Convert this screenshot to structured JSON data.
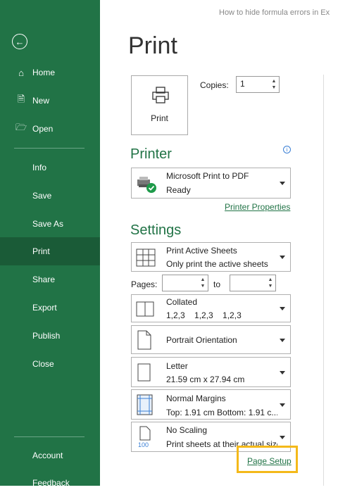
{
  "window": {
    "title": "How to hide formula errors in Ex"
  },
  "sidebar": {
    "items": [
      {
        "label": "Home"
      },
      {
        "label": "New"
      },
      {
        "label": "Open"
      },
      {
        "label": "Info"
      },
      {
        "label": "Save"
      },
      {
        "label": "Save As"
      },
      {
        "label": "Print"
      },
      {
        "label": "Share"
      },
      {
        "label": "Export"
      },
      {
        "label": "Publish"
      },
      {
        "label": "Close"
      },
      {
        "label": "Account"
      },
      {
        "label": "Feedback"
      }
    ],
    "selected": "Print"
  },
  "main": {
    "title": "Print",
    "print_button": "Print",
    "copies_label": "Copies:",
    "copies_value": "1",
    "printer_heading": "Printer",
    "printer": {
      "name": "Microsoft Print to PDF",
      "status": "Ready"
    },
    "printer_properties": "Printer Properties",
    "settings_heading": "Settings",
    "settings": {
      "sheets": {
        "line1": "Print Active Sheets",
        "line2": "Only print the active sheets"
      },
      "pages_label": "Pages:",
      "pages_from": "",
      "to_label": "to",
      "pages_to": "",
      "collation": {
        "line1": "Collated",
        "line2": "1,2,3    1,2,3    1,2,3"
      },
      "orientation": {
        "line1": "Portrait Orientation"
      },
      "paper": {
        "line1": "Letter",
        "line2": "21.59 cm x 27.94 cm"
      },
      "margins": {
        "line1": "Normal Margins",
        "line2": "Top: 1.91 cm Bottom: 1.91 c..."
      },
      "scaling": {
        "line1": "No Scaling",
        "line2": "Print sheets at their actual size"
      }
    },
    "page_setup": "Page Setup"
  },
  "colors": {
    "accent": "#217346",
    "accent_dark": "#1a5b37",
    "highlight": "#f4b91a"
  }
}
